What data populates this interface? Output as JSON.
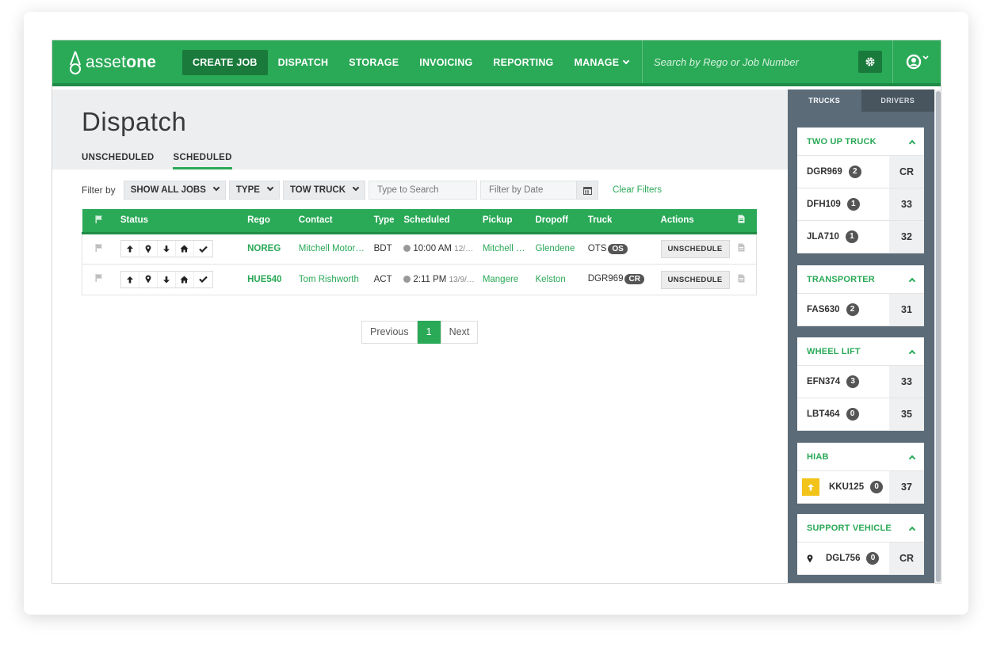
{
  "brand": {
    "name_light": "asset",
    "name_bold": "one"
  },
  "nav": {
    "create_job": "CREATE JOB",
    "dispatch": "DISPATCH",
    "storage": "STORAGE",
    "invoicing": "INVOICING",
    "reporting": "REPORTING",
    "manage": "MANAGE"
  },
  "search": {
    "placeholder": "Search by Rego or Job Number"
  },
  "page": {
    "title": "Dispatch",
    "tabs": {
      "unscheduled": "UNSCHEDULED",
      "scheduled": "SCHEDULED"
    }
  },
  "filters": {
    "label": "Filter by",
    "jobs": "SHOW ALL JOBS",
    "type": "TYPE",
    "tow_truck": "TOW TRUCK",
    "search_placeholder": "Type to Search",
    "date_placeholder": "Filter by Date",
    "clear": "Clear Filters"
  },
  "table": {
    "headers": {
      "status": "Status",
      "rego": "Rego",
      "contact": "Contact",
      "type": "Type",
      "scheduled": "Scheduled",
      "pickup": "Pickup",
      "dropoff": "Dropoff",
      "truck": "Truck",
      "actions": "Actions"
    },
    "rows": [
      {
        "rego": "NOREG",
        "contact": "Mitchell Motor…",
        "type": "BDT",
        "time": "10:00 AM",
        "date": "12/…",
        "pickup": "Mitchell …",
        "dropoff": "Glendene",
        "truck": "OTS",
        "truck_badge": "OS",
        "action": "UNSCHEDULE"
      },
      {
        "rego": "HUE540",
        "contact": "Tom Rishworth",
        "type": "ACT",
        "time": "2:11 PM",
        "date": "13/9/…",
        "pickup": "Mangere",
        "dropoff": "Kelston",
        "truck": "DGR969",
        "truck_badge": "CR",
        "action": "UNSCHEDULE"
      }
    ]
  },
  "pagination": {
    "previous": "Previous",
    "current": "1",
    "next": "Next"
  },
  "sidebar": {
    "tabs": {
      "trucks": "TRUCKS",
      "drivers": "DRIVERS"
    },
    "groups": [
      {
        "title": "TWO UP TRUCK",
        "trucks": [
          {
            "rego": "DGR969",
            "count": "2",
            "value": "CR"
          },
          {
            "rego": "DFH109",
            "count": "1",
            "value": "33"
          },
          {
            "rego": "JLA710",
            "count": "1",
            "value": "32"
          }
        ]
      },
      {
        "title": "TRANSPORTER",
        "trucks": [
          {
            "rego": "FAS630",
            "count": "2",
            "value": "31"
          }
        ]
      },
      {
        "title": "WHEEL LIFT",
        "trucks": [
          {
            "rego": "EFN374",
            "count": "3",
            "value": "33"
          },
          {
            "rego": "LBT464",
            "count": "0",
            "value": "35"
          }
        ]
      },
      {
        "title": "HIAB",
        "trucks": [
          {
            "rego": "KKU125",
            "count": "0",
            "value": "37"
          }
        ]
      },
      {
        "title": "SUPPORT VEHICLE",
        "trucks": [
          {
            "rego": "DGL756",
            "count": "0",
            "value": "CR"
          }
        ]
      }
    ]
  },
  "colors": {
    "brand_green": "#2aa957",
    "dark_green": "#1a7a3c",
    "sidebar_slate": "#5b6b78",
    "alert_yellow": "#f2c318"
  },
  "icons": [
    "logo-drop-icon",
    "caret-down-icon",
    "gear-icon",
    "user-circle-icon",
    "flag-icon",
    "arrow-up-icon",
    "map-pin-icon",
    "arrow-down-icon",
    "home-icon",
    "check-icon",
    "clock-icon",
    "file-icon",
    "calendar-icon",
    "chevron-up-icon"
  ]
}
